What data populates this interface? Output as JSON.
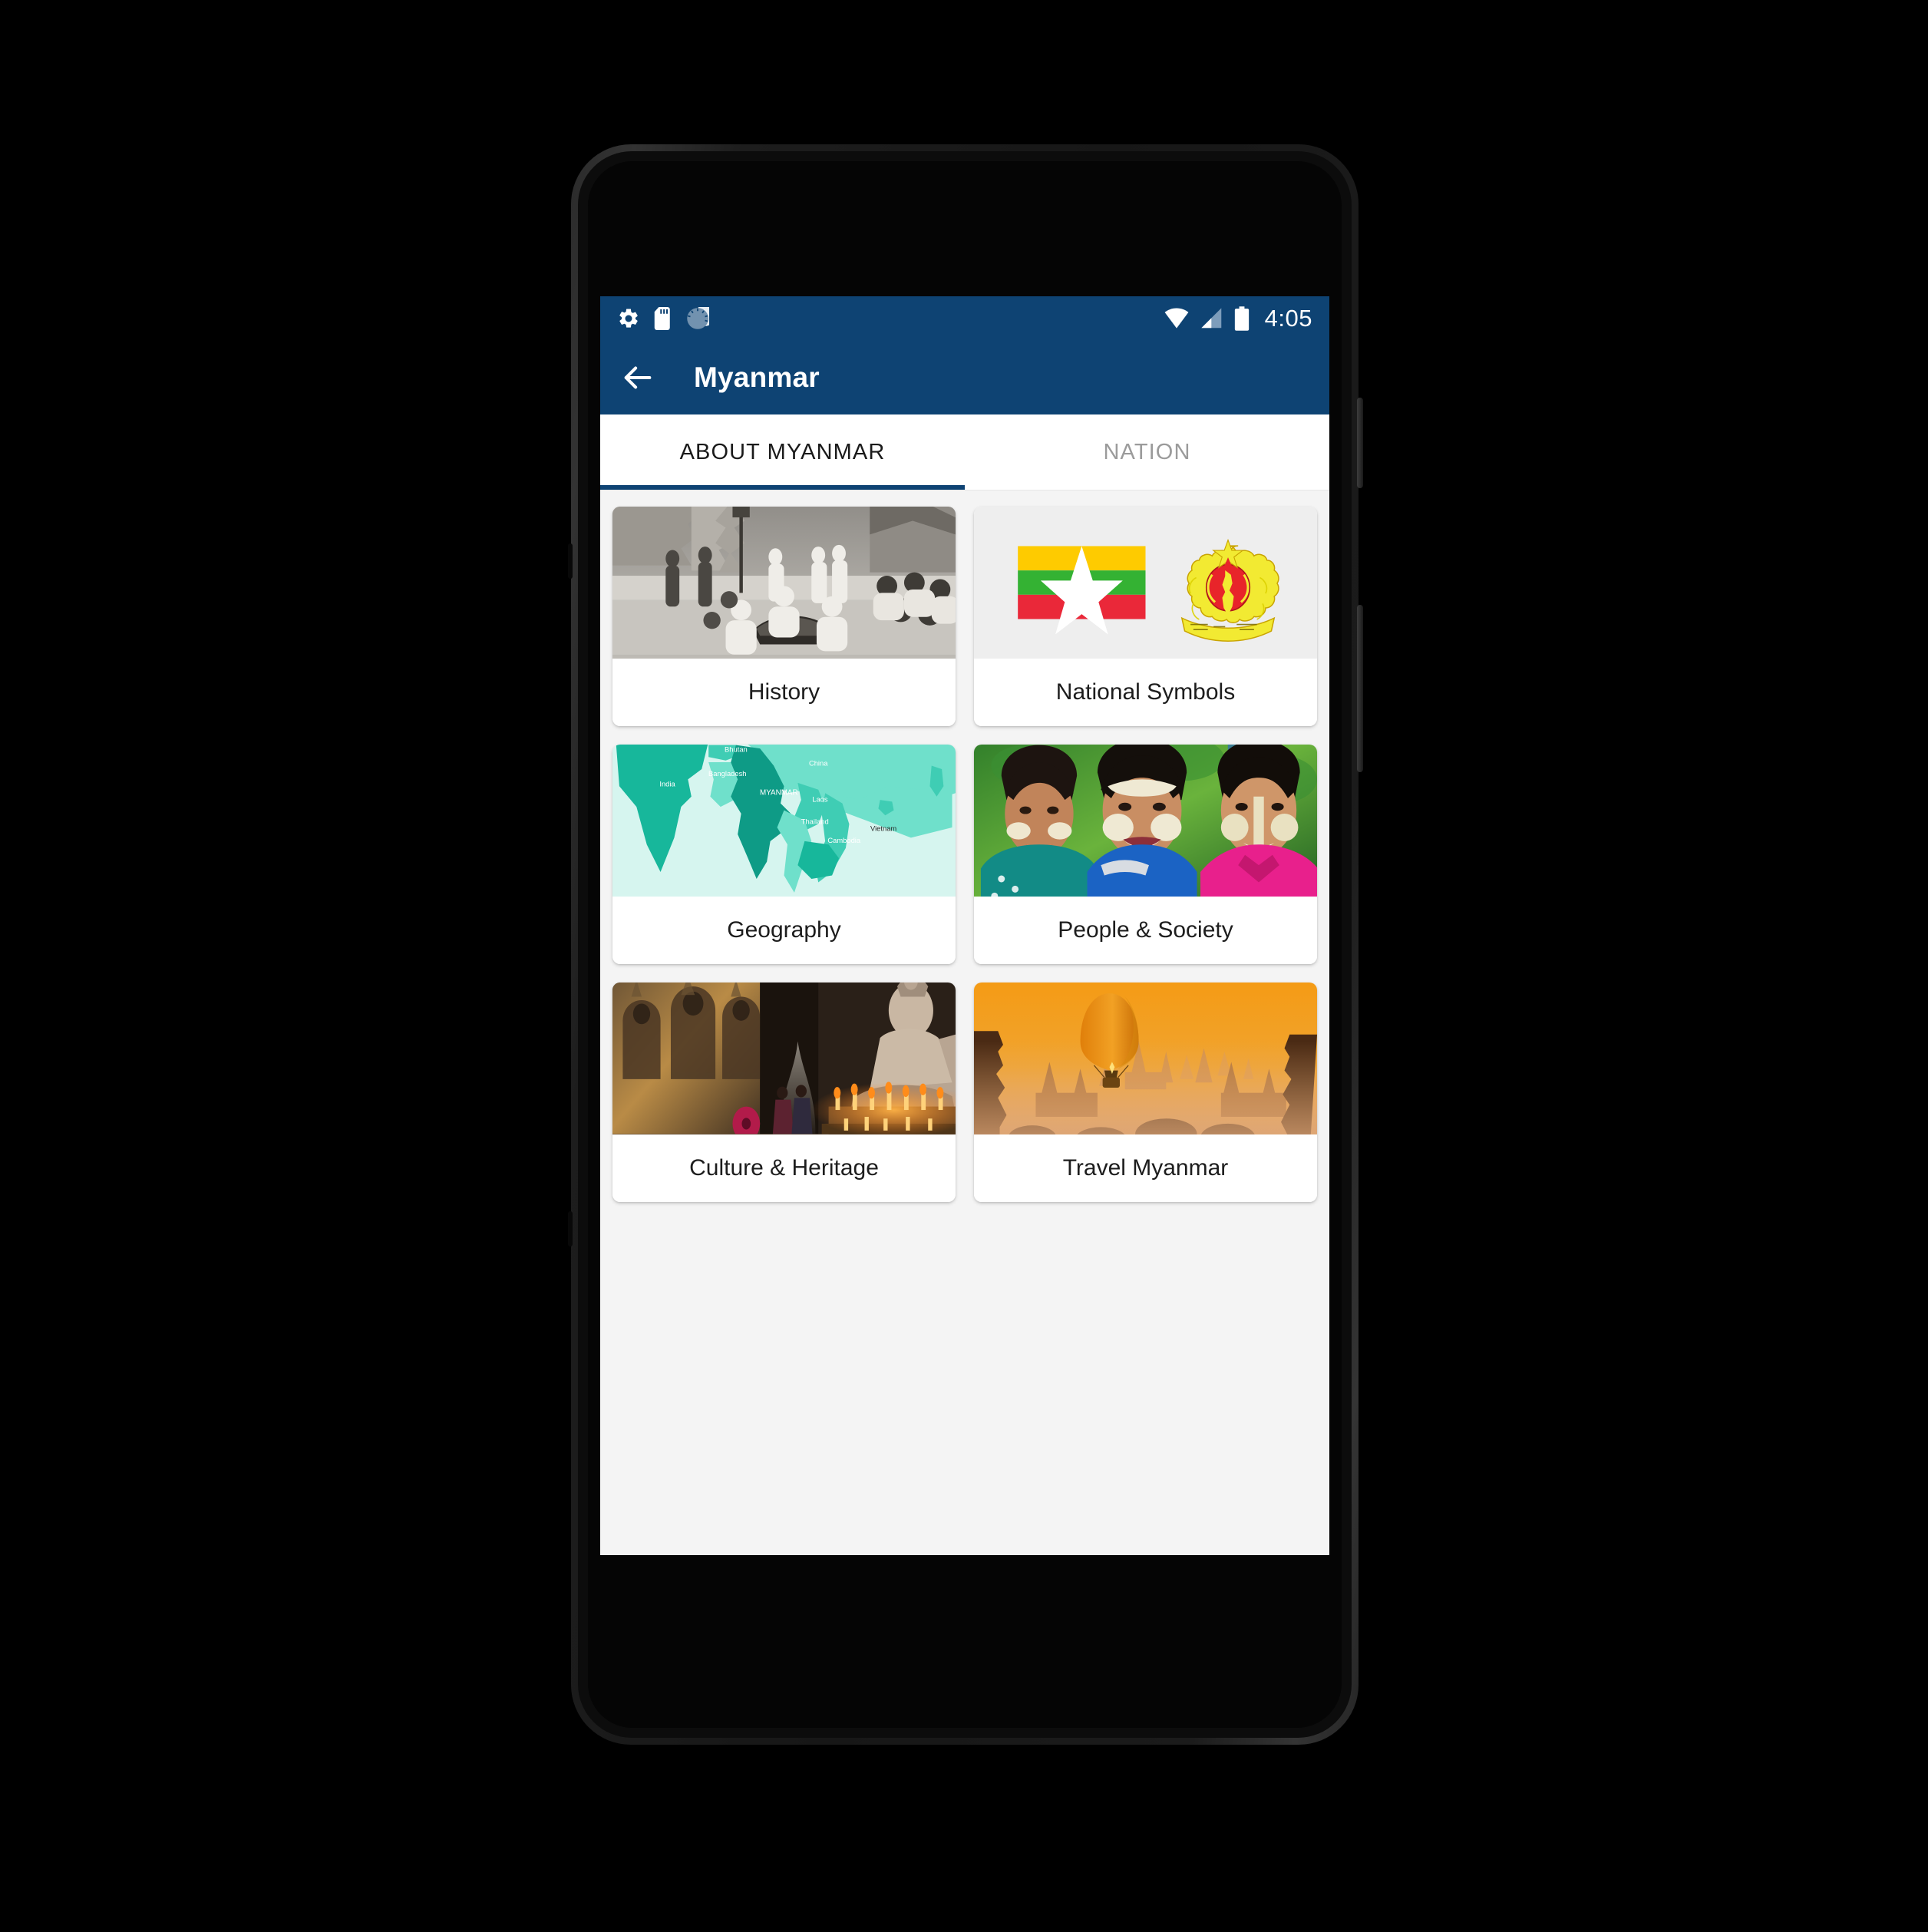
{
  "status_bar": {
    "time": "4:05",
    "left_icons": [
      "gear-icon",
      "sd-card-icon",
      "sync-spinner-icon"
    ],
    "right_icons": [
      "wifi-icon",
      "cellular-signal-icon",
      "battery-icon"
    ],
    "background_color": "#0e4373"
  },
  "app_bar": {
    "back_label": "Back",
    "title": "Myanmar",
    "background_color": "#0e4373",
    "text_color": "#ffffff"
  },
  "tabs": {
    "items": [
      {
        "label": "ABOUT MYANMAR",
        "active": true
      },
      {
        "label": "NATION",
        "active": false
      }
    ],
    "indicator_color": "#0e4373",
    "inactive_color": "#9b9b9b"
  },
  "grid": {
    "cards": [
      {
        "label": "History",
        "thumb": "historic-black-and-white-photo-of-burmese-musicians-at-pagoda"
      },
      {
        "label": "National Symbols",
        "thumb": "myanmar-flag-and-state-seal",
        "flag_colors": {
          "top": "#FECB00",
          "middle": "#34B233",
          "bottom": "#EA2839",
          "star": "#ffffff"
        },
        "seal_colors": {
          "gold": "#F2EA32",
          "red": "#E8242A"
        }
      },
      {
        "label": "Geography",
        "thumb": "teal-map-of-southeast-asia-highlighting-myanmar",
        "map_labels": [
          "Bhutan",
          "China",
          "Bangladesh",
          "India",
          "MYANMAR",
          "Laos",
          "Thailand",
          "Vietnam",
          "Cambodia"
        ],
        "map_colors": {
          "sea": "#d6f5ef",
          "neighbor_light": "#6fe0cb",
          "neighbor_mid": "#3fcdb4",
          "neighbor_dark": "#17b79b",
          "myanmar": "#0e9b86"
        }
      },
      {
        "label": "People & Society",
        "thumb": "three-young-people-with-thanaka-face-paint"
      },
      {
        "label": "Culture & Heritage",
        "thumb": "temple-interior-with-buddha-statue-and-candles"
      },
      {
        "label": "Travel Myanmar",
        "thumb": "hot-air-balloon-over-bagan-temples-at-sunrise",
        "sky_colors": {
          "top": "#F59A12",
          "bottom": "#E9B07C"
        }
      }
    ]
  },
  "nav_bar": {
    "buttons": [
      {
        "name": "back",
        "glyph": "triangle-left"
      },
      {
        "name": "home",
        "glyph": "circle"
      },
      {
        "name": "recents",
        "glyph": "square"
      }
    ],
    "color": "#a6a6a6"
  }
}
